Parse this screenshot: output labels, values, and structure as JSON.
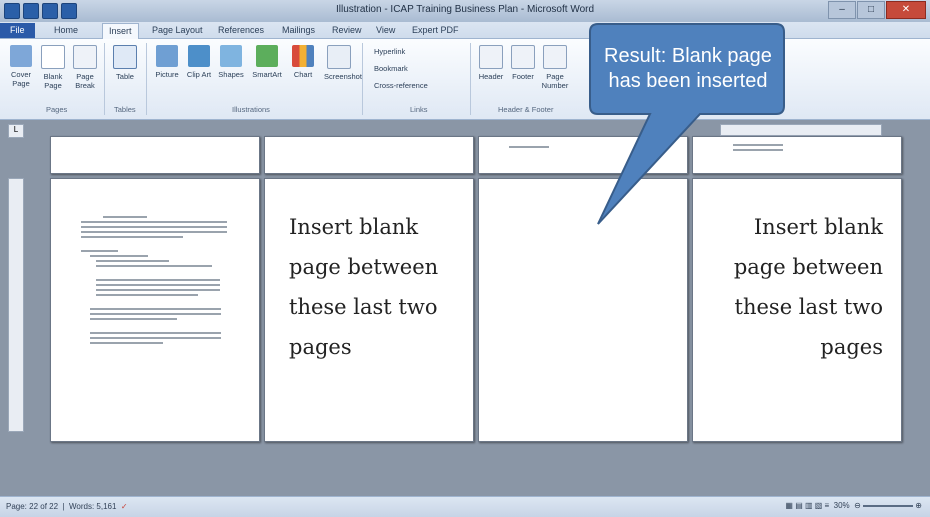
{
  "window": {
    "title": "Illustration - ICAP Training Business Plan - Microsoft Word"
  },
  "tabs": [
    "File",
    "Home",
    "Insert",
    "Page Layout",
    "References",
    "Mailings",
    "Review",
    "View",
    "Expert PDF"
  ],
  "ribbon": {
    "pages_buttons": [
      "Cover Page",
      "Blank Page",
      "Page Break"
    ],
    "tables_buttons": [
      "Table"
    ],
    "illustrations_buttons": [
      "Picture",
      "Clip Art",
      "Shapes",
      "SmartArt",
      "Chart",
      "Screenshot"
    ],
    "links_items": [
      "Hyperlink",
      "Bookmark",
      "Cross-reference"
    ],
    "header_footer_buttons": [
      "Header",
      "Footer",
      "Page Number"
    ],
    "group_labels": {
      "pages": "Pages",
      "tables": "Tables",
      "illustrations": "Illustrations",
      "links": "Links",
      "header_footer": "Header & Footer"
    }
  },
  "callout": {
    "text": "Result: Blank page has been inserted",
    "color": "#4f81bd"
  },
  "pages": {
    "second_text": "Insert blank page between these last two pages",
    "fourth_text": "Insert blank page between these last two pages"
  },
  "statusbar": {
    "page": "Page: 22 of 22",
    "words": "Words: 5,161",
    "zoom": "30%"
  }
}
